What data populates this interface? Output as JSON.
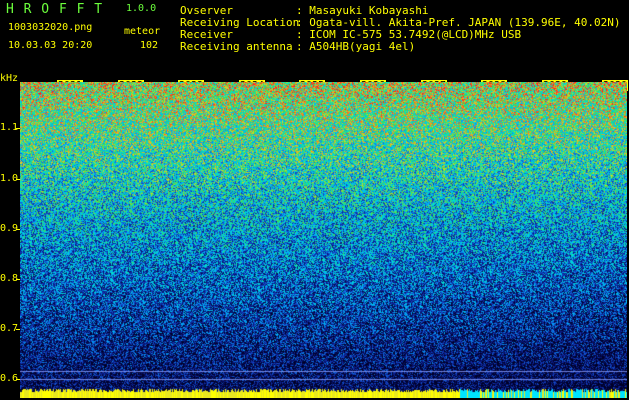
{
  "header": {
    "app_title": "H R O F F T",
    "version": "1.0.0",
    "filename": "1003032020.png",
    "mode": "meteor",
    "datetime": "10.03.03 20:20",
    "count": "102"
  },
  "station": {
    "observer_label": "Ovserver",
    "observer_value": ": Masayuki Kobayashi",
    "location_label": "Receiving Location",
    "location_value": ": Ogata-vill. Akita-Pref. JAPAN (139.96E, 40.02N)",
    "receiver_label": "Receiver",
    "receiver_value": ": ICOM IC-575 53.7492(@LCD)MHz USB",
    "antenna_label": "Receiving antenna",
    "antenna_value": ": A504HB(yagi 4el)"
  },
  "axes": {
    "y_unit": "kHz",
    "y_ticks": [
      "1.1",
      "1.0",
      "0.9",
      "0.8",
      "0.7",
      "0.6"
    ],
    "x_ticks": [
      "2021",
      "2022",
      "2023",
      "2024",
      "2025",
      "2026",
      "2027",
      "2028",
      "2029",
      "2030"
    ]
  },
  "colors": {
    "background": "#000000",
    "header_green": "#6cff3c",
    "header_yellow": "#ffff00",
    "noise_low": "#0a1a7a",
    "noise_mid": "#00c8ff",
    "noise_high": "#ff2020",
    "baseline_band": "#00e5ff"
  }
}
